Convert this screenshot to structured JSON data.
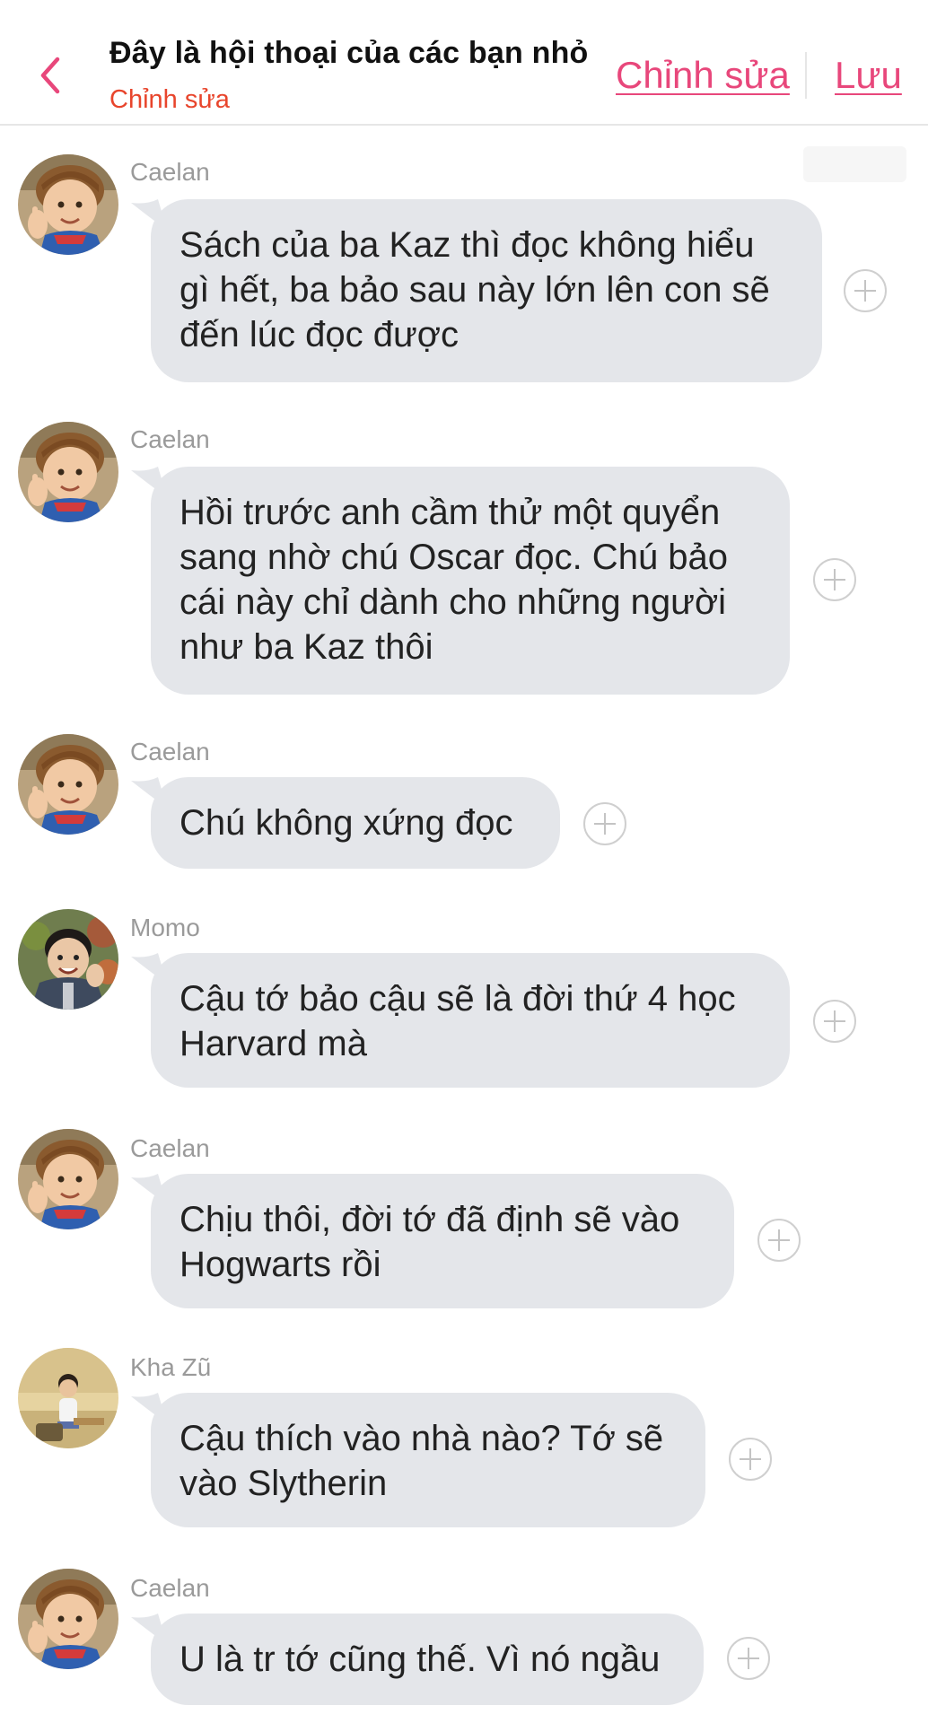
{
  "header": {
    "back_icon": "chevron-left-icon",
    "title": "Đây là hội thoại của các bạn nhỏ",
    "subtitle": "Chỉnh sửa",
    "edit_label": "Chỉnh sửa",
    "save_label": "Lưu",
    "accent_color": "#e8477b"
  },
  "messages": [
    {
      "sender": "Caelan",
      "text": "Sách của ba Kaz thì đọc không hiểu gì hết, ba bảo sau này lớn lên con sẽ đến lúc đọc được"
    },
    {
      "sender": "Caelan",
      "text": "Hồi trước anh cầm thử một quyển sang nhờ chú Oscar đọc. Chú bảo cái này chỉ dành cho những người như ba Kaz thôi"
    },
    {
      "sender": "Caelan",
      "text": "Chú không xứng đọc"
    },
    {
      "sender": "Momo",
      "text": "Cậu tớ bảo cậu sẽ là đời thứ 4 học Harvard mà"
    },
    {
      "sender": "Caelan",
      "text": "Chịu thôi, đời tớ đã định sẽ vào Hogwarts rồi"
    },
    {
      "sender": "Kha Zũ",
      "text": "Cậu thích vào nhà nào? Tớ sẽ vào Slytherin"
    },
    {
      "sender": "Caelan",
      "text": "U là tr tớ cũng thế. Vì nó ngầu"
    }
  ]
}
